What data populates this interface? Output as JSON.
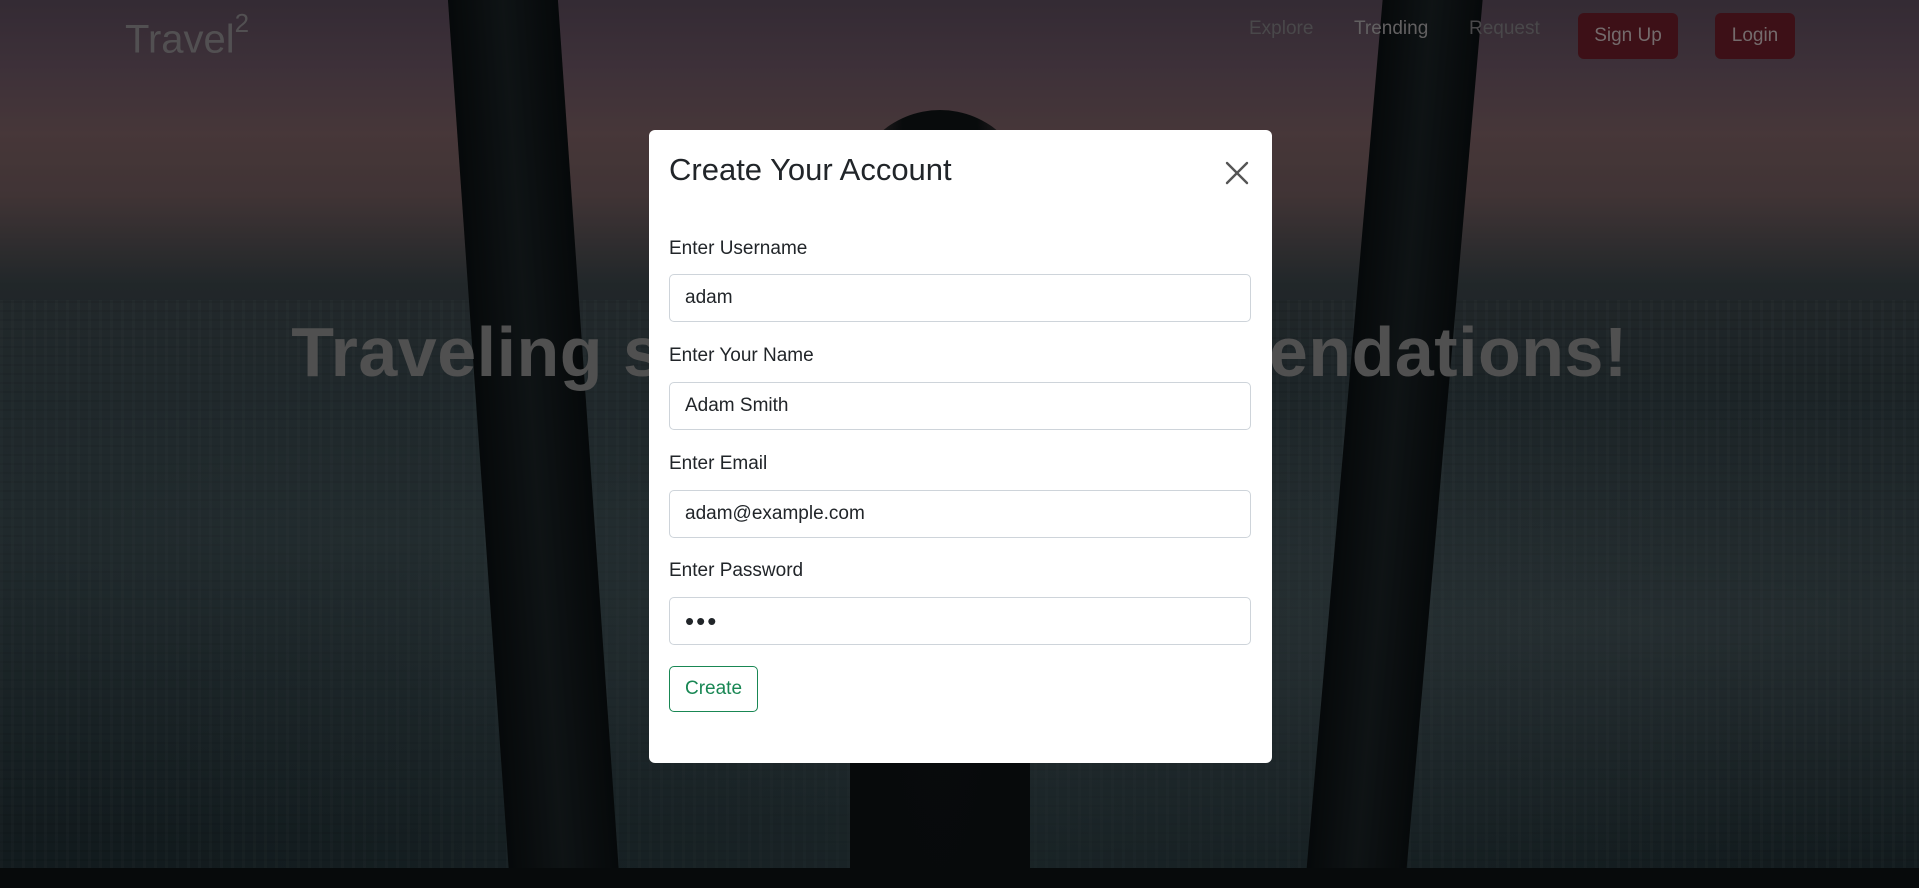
{
  "navbar": {
    "brand": "Travel",
    "brand_superscript": "2",
    "links": {
      "explore": "Explore",
      "trending": "Trending",
      "request": "Request"
    },
    "signup_label": "Sign Up",
    "login_label": "Login"
  },
  "hero": {
    "headline": "Traveling soon? Get recommendations!"
  },
  "modal": {
    "title": "Create Your Account",
    "close_icon": "close-icon",
    "fields": {
      "username": {
        "label": "Enter Username",
        "value": "adam"
      },
      "name": {
        "label": "Enter Your Name",
        "value": "Adam Smith"
      },
      "email": {
        "label": "Enter Email",
        "value": "adam@example.com"
      },
      "password": {
        "label": "Enter Password",
        "value": "abc"
      }
    },
    "submit_label": "Create"
  },
  "colors": {
    "brand_button": "#6a1d28",
    "create_button": "#198754"
  }
}
